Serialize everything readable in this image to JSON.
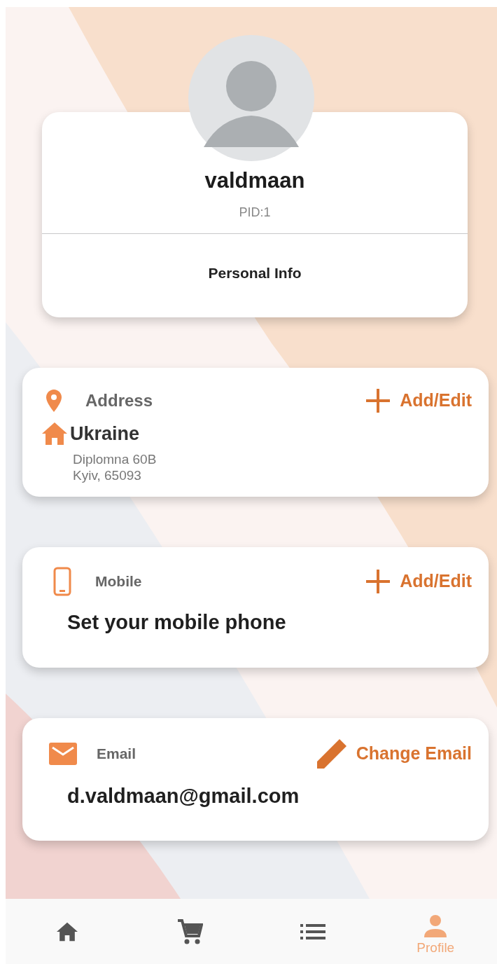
{
  "profile": {
    "username": "valdmaan",
    "pid": "PID:1",
    "section": "Personal Info"
  },
  "cards": [
    {
      "kind": "address",
      "title": "Address",
      "action": {
        "kind": "add",
        "label": "Add/Edit"
      },
      "country": "Ukraine",
      "lines": [
        "Diplomna 60B",
        "Kyiv, 65093"
      ]
    },
    {
      "kind": "mobile",
      "title": "Mobile",
      "action": {
        "kind": "add",
        "label": "Add/Edit"
      },
      "value": "Set your mobile phone"
    },
    {
      "kind": "email",
      "title": "Email",
      "action": {
        "kind": "edit",
        "label": "Change Email"
      },
      "value": "d.valdmaan@gmail.com"
    }
  ],
  "bottom_nav": [
    {
      "kind": "home",
      "selected": false
    },
    {
      "kind": "cart",
      "selected": false
    },
    {
      "kind": "list",
      "selected": false
    },
    {
      "kind": "profile",
      "label": "Profile",
      "selected": true
    }
  ]
}
